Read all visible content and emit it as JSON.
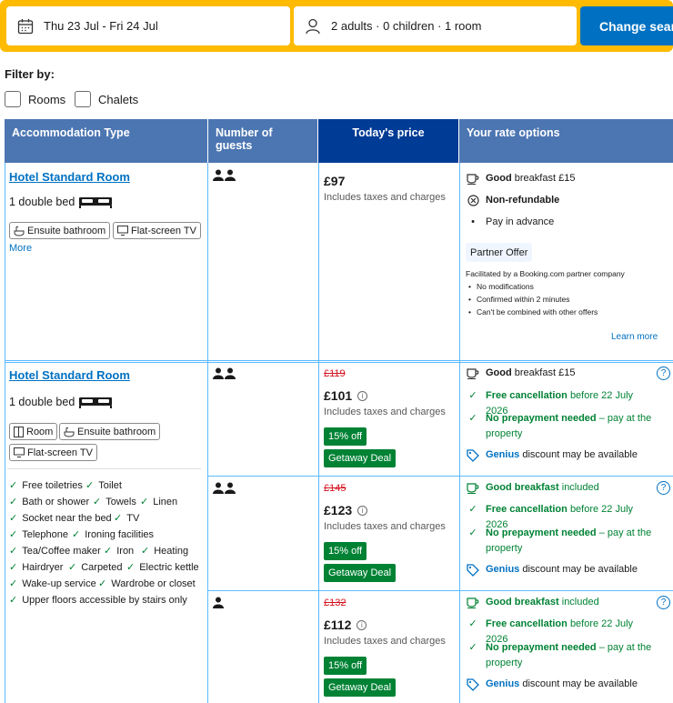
{
  "search": {
    "dates": "Thu 23 Jul - Fri 24 Jul",
    "guests": "2 adults · 0 children · 1 room",
    "button": "Change search"
  },
  "filter": {
    "title": "Filter by:",
    "options": [
      "Rooms",
      "Chalets"
    ]
  },
  "table": {
    "headers": [
      "Accommodation Type",
      "Number of guests",
      "Today's price",
      "Your rate options"
    ]
  },
  "rooms": [
    {
      "name": "Hotel Standard Room",
      "bed": "1 double bed",
      "tags": [
        "Ensuite bathroom",
        "Flat-screen TV"
      ],
      "more": "More",
      "rate": {
        "price": "£97",
        "taxes": "Includes taxes and charges",
        "breakfast_bold": "Good",
        "breakfast_rest": "breakfast £15",
        "nonrefundable": "Non-refundable",
        "pay": "Pay in advance",
        "partner": "Partner Offer",
        "facilitated": "Facilitated by a Booking.com partner company",
        "facil_items": [
          "No modifications",
          "Confirmed within 2 minutes",
          "Can't be combined with other offers"
        ],
        "learn_more": "Learn more"
      }
    },
    {
      "name": "Hotel Standard Room",
      "bed": "1 double bed",
      "tags": [
        "Room",
        "Ensuite bathroom",
        "Flat-screen TV"
      ],
      "amenities": [
        [
          "Free toiletries",
          "Toilet"
        ],
        [
          "Bath or shower",
          "Towels",
          "Linen"
        ],
        [
          "Socket near the bed",
          "TV"
        ],
        [
          "Telephone",
          "Ironing facilities"
        ],
        [
          "Tea/Coffee maker",
          "Iron",
          "Heating"
        ],
        [
          "Hairdryer",
          "Carpeted",
          "Electric kettle"
        ],
        [
          "Wake-up service",
          "Wardrobe or closet"
        ],
        [
          "Upper floors accessible by stairs only"
        ]
      ],
      "rates": [
        {
          "old_price": "£119",
          "price": "£101",
          "taxes": "Includes taxes and charges",
          "discount": "15% off",
          "deal": "Getaway Deal",
          "breakfast_bold": "Good",
          "breakfast_rest": "breakfast £15",
          "cancel_bold": "Free cancellation",
          "cancel_rest": "before 22 July 2026",
          "prepay_bold": "No prepayment needed",
          "prepay_rest": "– pay at the property",
          "genius_bold": "Genius",
          "genius_rest": "discount may be available"
        },
        {
          "old_price": "£145",
          "price": "£123",
          "taxes": "Includes taxes and charges",
          "discount": "15% off",
          "deal": "Getaway Deal",
          "breakfast_bold": "Good breakfast",
          "breakfast_rest": "included",
          "cancel_bold": "Free cancellation",
          "cancel_rest": "before 22 July 2026",
          "prepay_bold": "No prepayment needed",
          "prepay_rest": "– pay at the property",
          "genius_bold": "Genius",
          "genius_rest": "discount may be available"
        },
        {
          "old_price": "£132",
          "price": "£112",
          "taxes": "Includes taxes and charges",
          "discount": "15% off",
          "deal": "Getaway Deal",
          "breakfast_bold": "Good breakfast",
          "breakfast_rest": "included",
          "cancel_bold": "Free cancellation",
          "cancel_rest": "before 22 July 2026",
          "prepay_bold": "No prepayment needed",
          "prepay_rest": "– pay at the property",
          "genius_bold": "Genius",
          "genius_rest": "discount may be available"
        }
      ]
    }
  ],
  "icons": {
    "calendar": "calendar-icon",
    "person": "person-icon",
    "bed": "bed-icon",
    "check": "check-icon",
    "cup": "coffee-cup-icon",
    "info": "info-icon",
    "question": "question-icon",
    "tag": "genius-tag-icon"
  },
  "colors": {
    "search_bar": "#febb02",
    "button": "#0071c2",
    "header": "#4c76b2",
    "price_header": "#003b95",
    "green": "#008234",
    "strike_red": "#d4111e"
  }
}
